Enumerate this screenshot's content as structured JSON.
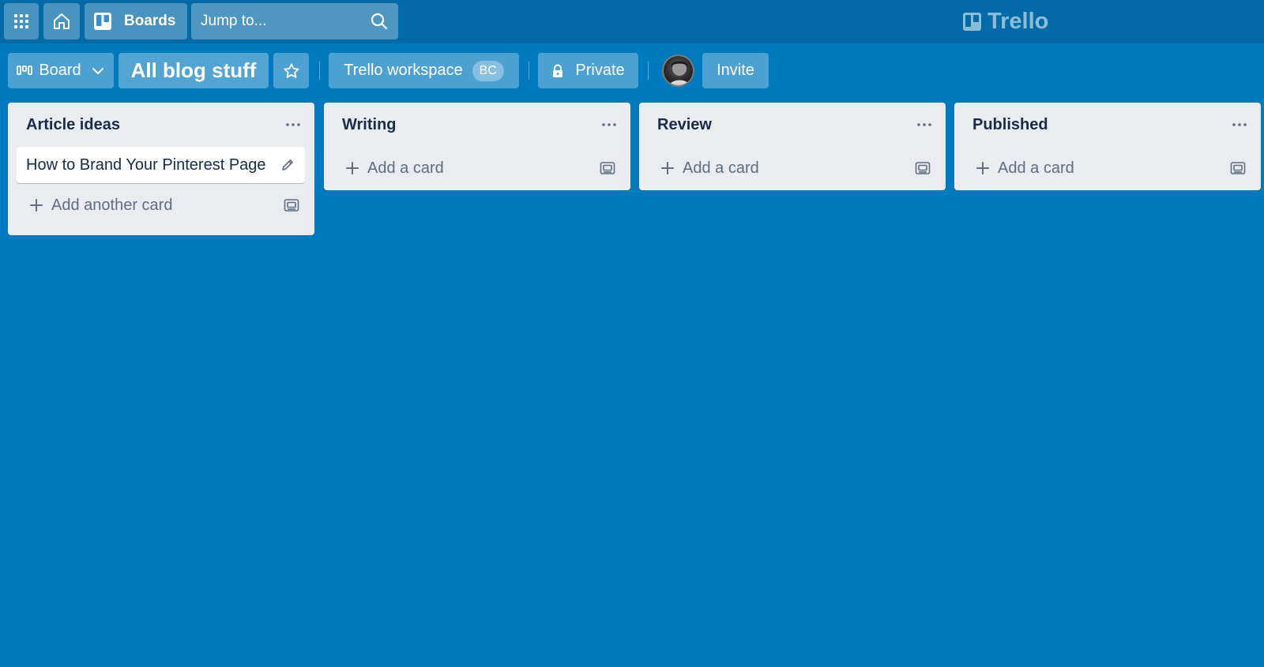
{
  "topbar": {
    "boards_label": "Boards",
    "search_placeholder": "Jump to...",
    "logo_text": "Trello"
  },
  "board_header": {
    "view_label": "Board",
    "board_title": "All blog stuff",
    "workspace_label": "Trello workspace",
    "workspace_badge": "BC",
    "visibility_label": "Private",
    "invite_label": "Invite"
  },
  "lists": [
    {
      "title": "Article ideas",
      "cards": [
        "How to Brand Your Pinterest Page"
      ],
      "add_label": "Add another card"
    },
    {
      "title": "Writing",
      "cards": [],
      "add_label": "Add a card"
    },
    {
      "title": "Review",
      "cards": [],
      "add_label": "Add a card"
    },
    {
      "title": "Published",
      "cards": [],
      "add_label": "Add a card"
    }
  ],
  "colors": {
    "board_background": "#0079bf",
    "topbar_background": "#026aa7",
    "list_background": "#ebecf0",
    "text_dark": "#172b4d",
    "text_muted": "#5e6c84"
  }
}
